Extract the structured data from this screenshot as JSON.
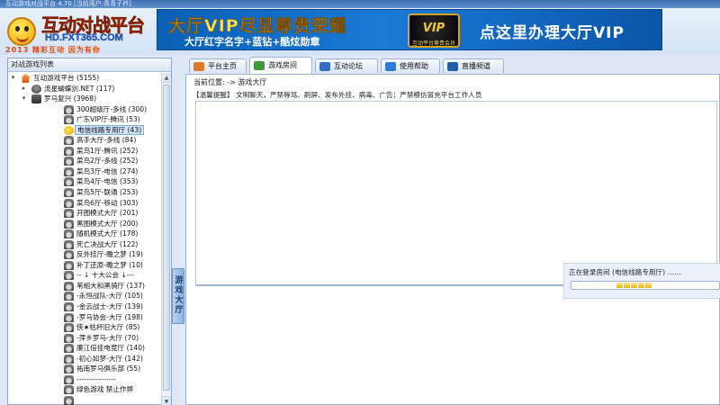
{
  "window": {
    "title": "互动游戏对战平台 4.70 [当前用户:青青子衿]"
  },
  "banner": {
    "logo_title": "互动对战平台",
    "logo_url": "HD.FXT365.COM",
    "logo_slogan": "2013 精彩互动 因为有你",
    "ad_main": "大厅VIP尽显尊贵荣耀",
    "ad_sub": "大厅红字名字+蓝钻+酷炫勋章",
    "ad_badge": "VIP",
    "ad_badge_caption": "互动平台尊贵会员",
    "ad_right": "点这里办理大厅VIP"
  },
  "left_panel": {
    "header": "对战游戏列表",
    "tree": [
      {
        "label": "互动游戏平台 (5155)",
        "icon": "home-icon",
        "level": 0,
        "expander": "-"
      },
      {
        "label": "流星蝴蝶剑.NET (117)",
        "icon": "dragon-icon",
        "level": 1,
        "expander": "+"
      },
      {
        "label": "罗马复兴 (3968)",
        "icon": "arena-icon",
        "level": 1,
        "expander": "-"
      },
      {
        "label": "300超级厅-多线 (300)",
        "icon": "room-icon",
        "level": 2
      },
      {
        "label": "广东VIP厅-腾讯 (53)",
        "icon": "room-icon",
        "level": 2
      },
      {
        "label": "电信线路专用厅 (43)",
        "icon": "smile-icon",
        "level": 2,
        "selected": true
      },
      {
        "label": "高手大厅-多线 (84)",
        "icon": "room-icon",
        "level": 2
      },
      {
        "label": "菜鸟1厅-腾讯 (252)",
        "icon": "room-icon",
        "level": 2
      },
      {
        "label": "菜鸟2厅-多线 (252)",
        "icon": "room-icon",
        "level": 2
      },
      {
        "label": "菜鸟3厅-电信 (274)",
        "icon": "room-icon",
        "level": 2
      },
      {
        "label": "菜鸟4厅-电信 (353)",
        "icon": "room-icon",
        "level": 2
      },
      {
        "label": "菜鸟5厅-联通 (253)",
        "icon": "room-icon",
        "level": 2
      },
      {
        "label": "菜鸟6厅-移动 (303)",
        "icon": "room-icon",
        "level": 2
      },
      {
        "label": "开图模式大厅 (201)",
        "icon": "room-icon",
        "level": 2
      },
      {
        "label": "黑图模式大厅 (200)",
        "icon": "room-icon",
        "level": 2
      },
      {
        "label": "随机模式大厅 (178)",
        "icon": "room-icon",
        "level": 2
      },
      {
        "label": "死亡决战大厅 (122)",
        "icon": "room-icon",
        "level": 2
      },
      {
        "label": "反外挂厅-瞻之梦 (19)",
        "icon": "room-icon",
        "level": 2
      },
      {
        "label": "补丁还原-瞻之梦 (10)",
        "icon": "room-icon",
        "level": 2
      },
      {
        "label": "-- ↓  十大公会  ↓---",
        "icon": "room-icon",
        "level": 2
      },
      {
        "label": "苇組大和黑骑厅 (137)",
        "icon": "room-icon",
        "level": 2
      },
      {
        "label": "-永恒战队-大厅 (105)",
        "icon": "room-icon",
        "level": 2
      },
      {
        "label": "-金云战士-大厅 (139)",
        "icon": "room-icon",
        "level": 2
      },
      {
        "label": "-罗马协会-大厅 (198)",
        "icon": "room-icon",
        "level": 2
      },
      {
        "label": "侠★枯杯旧大厅 (85)",
        "icon": "room-icon",
        "level": 2
      },
      {
        "label": "-萍乡罗马-大厅 (70)",
        "icon": "room-icon",
        "level": 2
      },
      {
        "label": "廉江倍佳电竞厅 (140)",
        "icon": "room-icon",
        "level": 2
      },
      {
        "label": "-初心如梦-大厅 (142)",
        "icon": "room-icon",
        "level": 2
      },
      {
        "label": "祐南罗马俱乐部 (55)",
        "icon": "room-icon",
        "level": 2
      },
      {
        "label": "----------------",
        "icon": "room-icon",
        "level": 2
      },
      {
        "label": "绿色游戏  禁止作弊",
        "icon": "room-icon",
        "level": 2
      },
      {
        "label": "",
        "icon": "room-icon",
        "level": 2
      }
    ]
  },
  "splitter": {
    "label": "游戏大厅"
  },
  "tabs": [
    {
      "label": "平台主页",
      "icon": "home-icon",
      "color": "#e07a2a"
    },
    {
      "label": "游戏房间",
      "icon": "game-room-icon",
      "color": "#3f9a3a",
      "active": true
    },
    {
      "label": "互动论坛",
      "icon": "forum-icon",
      "color": "#2f6fc4"
    },
    {
      "label": "使用帮助",
      "icon": "help-icon",
      "color": "#2a7bd6"
    },
    {
      "label": "直播频道",
      "icon": "live-icon",
      "color": "#1f5fae"
    }
  ],
  "content": {
    "location": "当前位置:    -> 游戏大厅",
    "tips": "【温馨提醒】 文明聊天，严禁辱骂、刷屏、发布外挂、病毒、广告；严禁模仿冒充平台工作人员",
    "login_status": "正在登录房间 (电信线路专用厅) ……",
    "login_progress": 0.3
  }
}
